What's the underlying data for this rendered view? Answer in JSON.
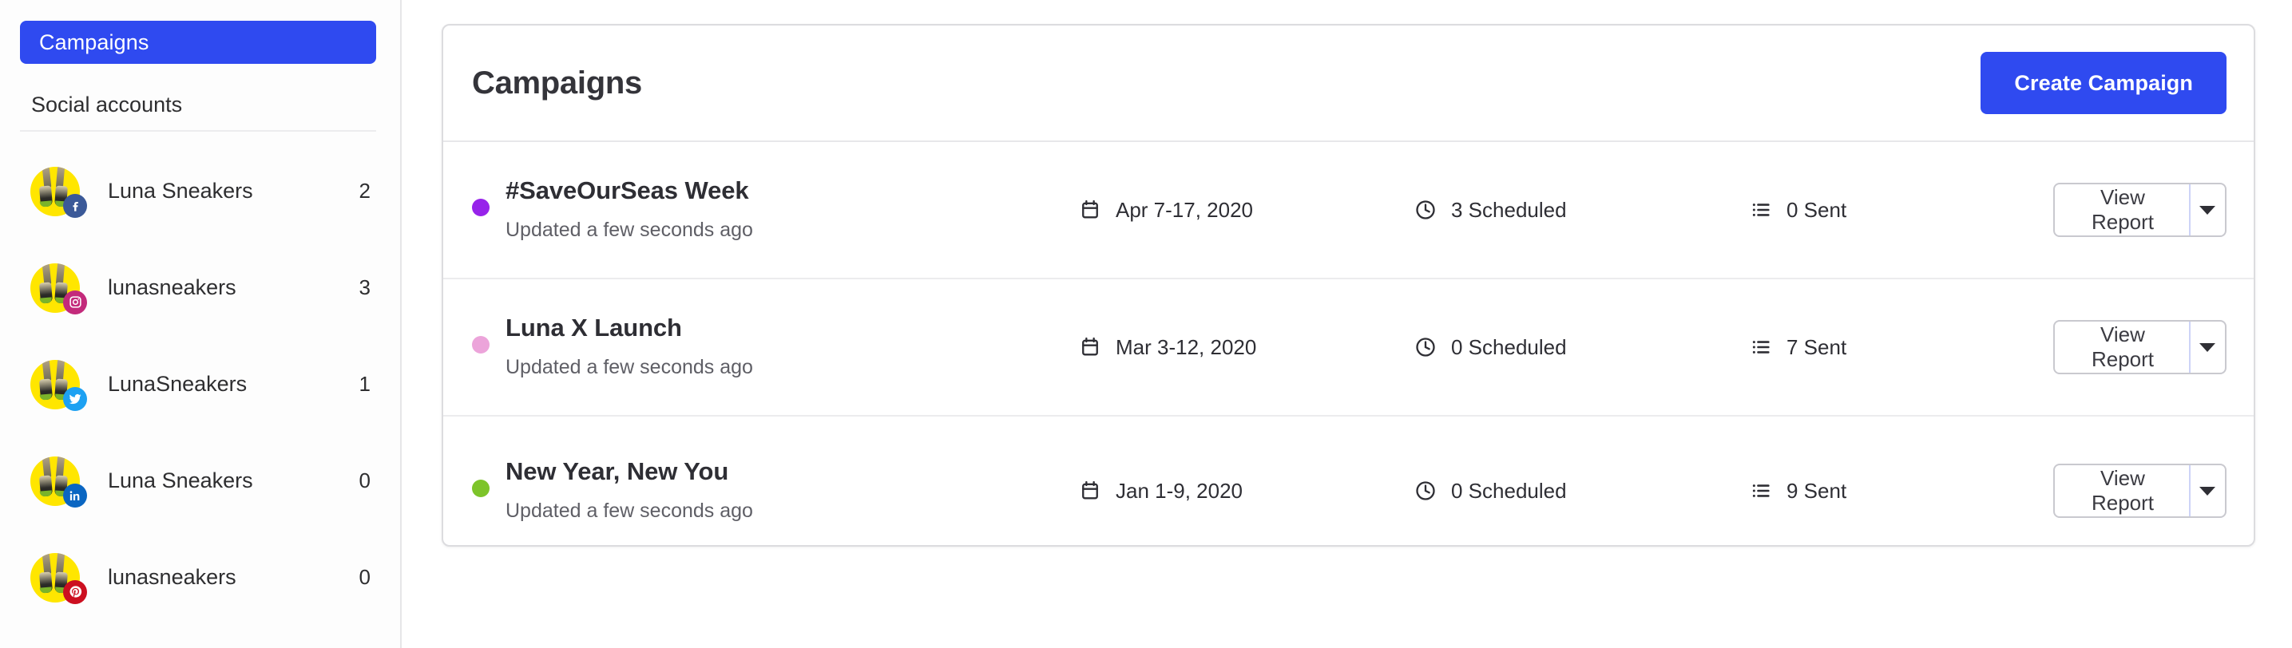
{
  "sidebar": {
    "nav": {
      "label": "Campaigns",
      "active": true,
      "accent": "#2f4af0"
    },
    "section_title": "Social accounts",
    "accounts": [
      {
        "name": "Luna Sneakers",
        "count": "2",
        "network": "facebook-icon",
        "badge_color": "#3b5998"
      },
      {
        "name": "lunasneakers",
        "count": "3",
        "network": "instagram-icon",
        "badge_color": "#c32a7b"
      },
      {
        "name": "LunaSneakers",
        "count": "1",
        "network": "twitter-icon",
        "badge_color": "#1da1f2"
      },
      {
        "name": "Luna Sneakers",
        "count": "0",
        "network": "linkedin-icon",
        "badge_color": "#0a66c2"
      },
      {
        "name": "lunasneakers",
        "count": "0",
        "network": "pinterest-icon",
        "badge_color": "#cc0f20"
      }
    ]
  },
  "card": {
    "title": "Campaigns",
    "create_button": "Create Campaign",
    "report_button": "View Report",
    "report_caret_icon": "chevron-down-icon",
    "icons": {
      "date": "calendar-icon",
      "scheduled": "clock-icon",
      "sent": "list-icon"
    },
    "campaigns": [
      {
        "name": "#SaveOurSeas Week",
        "updated": "Updated a few seconds ago",
        "dot_color": "#9723ea",
        "date": "Apr 7-17, 2020",
        "scheduled": "3 Scheduled",
        "sent": "0 Sent"
      },
      {
        "name": "Luna X Launch",
        "updated": "Updated a few seconds ago",
        "dot_color": "#eca4da",
        "date": "Mar 3-12, 2020",
        "scheduled": "0 Scheduled",
        "sent": "7 Sent"
      },
      {
        "name": "New Year, New You",
        "updated": "Updated a few seconds ago",
        "dot_color": "#7dc42a",
        "date": "Jan 1-9, 2020",
        "scheduled": "0 Scheduled",
        "sent": "9 Sent"
      }
    ]
  }
}
